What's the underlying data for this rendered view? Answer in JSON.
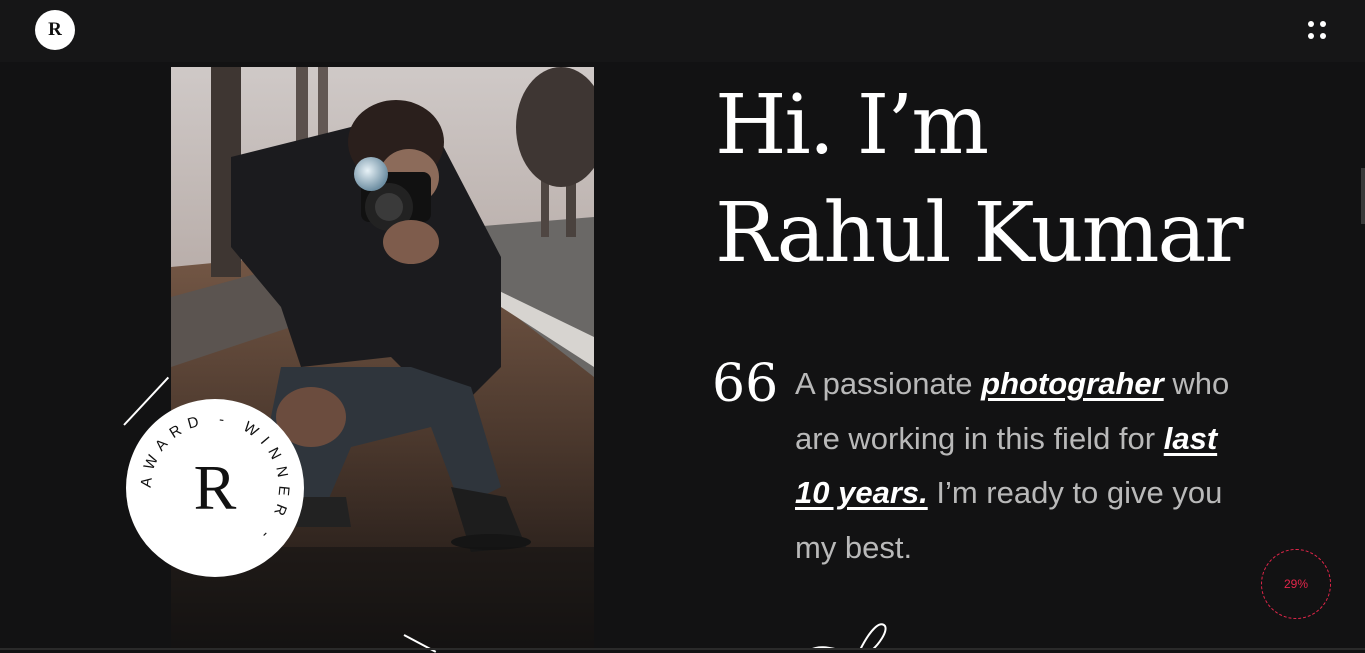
{
  "header": {
    "logo_letter": "R",
    "menu_icon": "grid-dots-icon"
  },
  "hero": {
    "title_line1": "Hi. I’m",
    "title_line2": "Rahul Kumar",
    "quote_mark": "66",
    "intro": {
      "part1": "A passionate ",
      "link1": "photograher",
      "part2": " who are working in this field for ",
      "link2": "last 10 years.",
      "part3": " I’m ready to give you my best."
    }
  },
  "badge": {
    "center_letter": "R",
    "ring_text": "AWARD - WINNER - "
  },
  "progress": {
    "label": "29%",
    "value_percent": 29
  },
  "colors": {
    "background": "#121213",
    "accent": "#e1264a",
    "text_primary": "#ffffff",
    "text_muted": "#b9b9b9"
  }
}
